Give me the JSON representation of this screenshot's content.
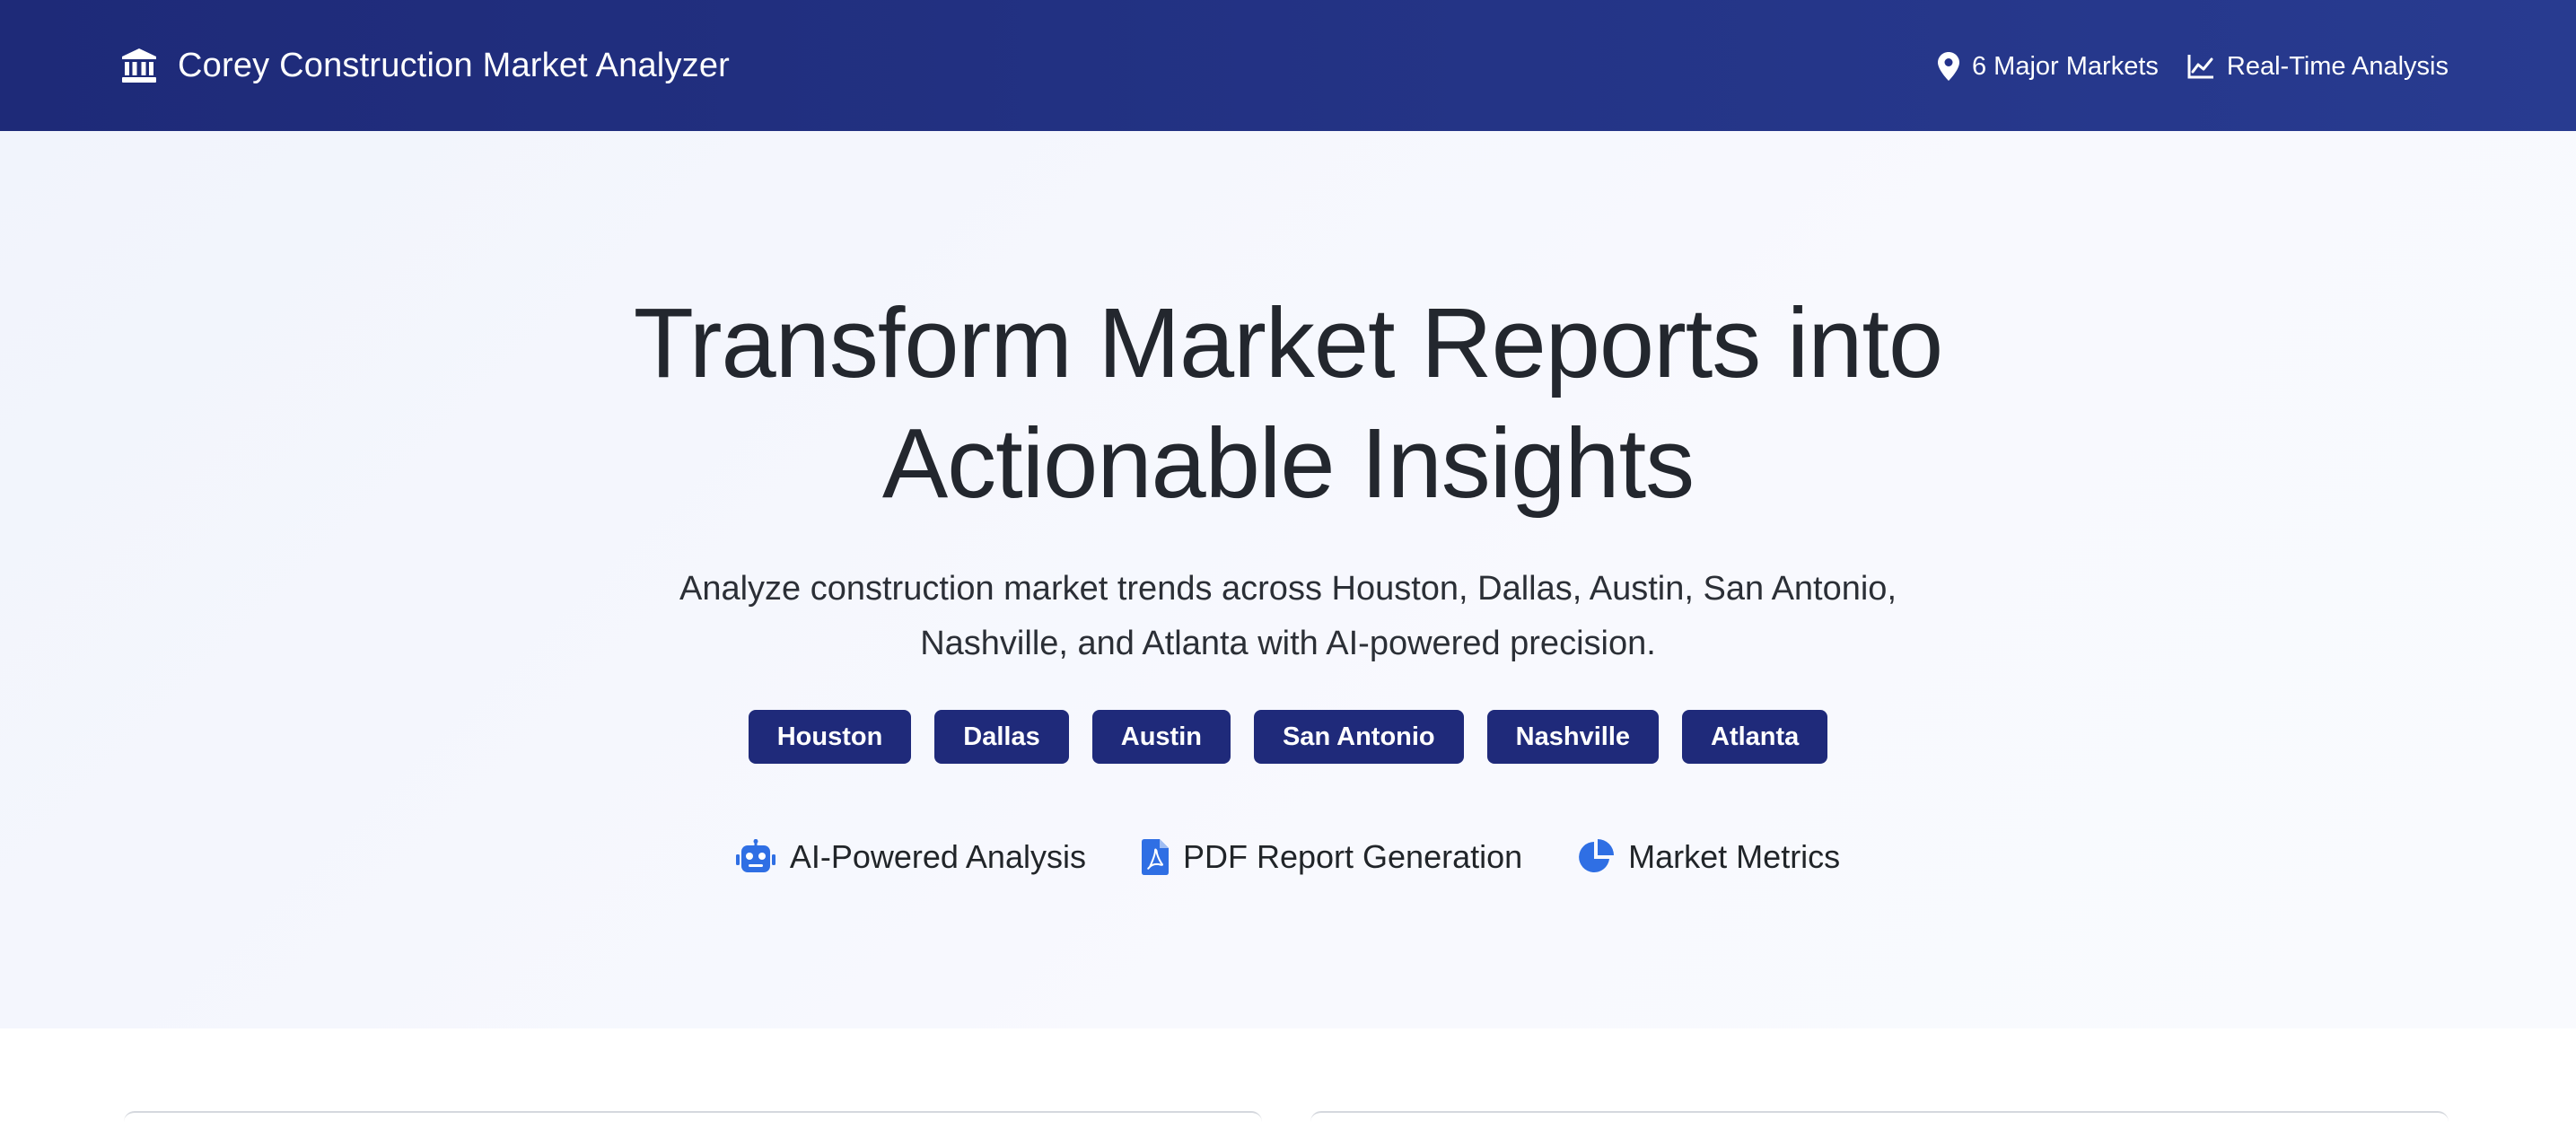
{
  "navbar": {
    "brand": {
      "icon": "bank-icon",
      "title": "Corey Construction Market Analyzer"
    },
    "items": [
      {
        "icon": "map-pin-icon",
        "label": "6 Major Markets"
      },
      {
        "icon": "line-chart-icon",
        "label": "Real-Time Analysis"
      }
    ]
  },
  "hero": {
    "title_line1": "Transform Market Reports into",
    "title_line2": "Actionable Insights",
    "subtitle_line1": "Analyze construction market trends across Houston, Dallas, Austin, San Antonio,",
    "subtitle_line2": "Nashville, and Atlanta with AI-powered precision.",
    "markets": [
      "Houston",
      "Dallas",
      "Austin",
      "San Antonio",
      "Nashville",
      "Atlanta"
    ],
    "features": [
      {
        "icon": "robot-icon",
        "label": "AI-Powered Analysis"
      },
      {
        "icon": "pdf-file-icon",
        "label": "PDF Report Generation"
      },
      {
        "icon": "pie-chart-icon",
        "label": "Market Metrics"
      }
    ]
  },
  "colors": {
    "navbar_start": "#1e2a78",
    "navbar_end": "#283b90",
    "chip_background": "#1f2a7a",
    "feature_icon": "#2f6fe4"
  }
}
